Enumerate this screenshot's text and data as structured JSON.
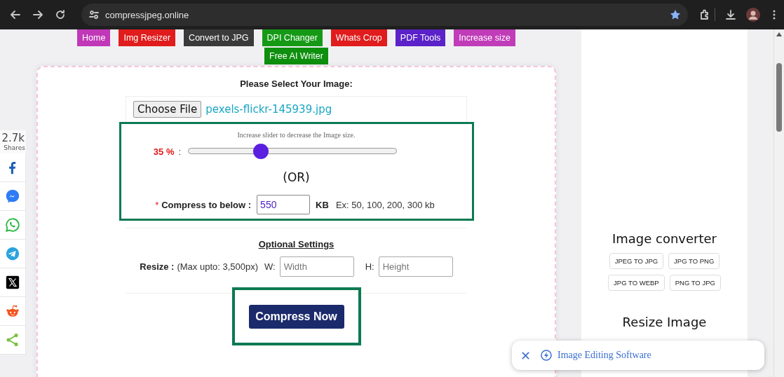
{
  "browser": {
    "url": "compressjpeg.online"
  },
  "nav": [
    {
      "label": "Home",
      "color": "#c038b8"
    },
    {
      "label": "Img Resizer",
      "color": "#e01c1c"
    },
    {
      "label": "Convert to JPG",
      "color": "#3a3a3a"
    },
    {
      "label": "DPI Changer",
      "color": "#169a16"
    },
    {
      "label": "Whats Crop",
      "color": "#e01c1c"
    },
    {
      "label": "PDF Tools",
      "color": "#5a22c8"
    },
    {
      "label": "Increase size",
      "color": "#c03cb8"
    },
    {
      "label": "Free AI Writer",
      "color": "#0e8f0e"
    }
  ],
  "share": {
    "count": "2.7k",
    "label": "Shares",
    "buttons": [
      {
        "kind": "facebook"
      },
      {
        "kind": "messenger"
      },
      {
        "kind": "whatsapp"
      },
      {
        "kind": "telegram"
      },
      {
        "kind": "x"
      },
      {
        "kind": "reddit"
      },
      {
        "kind": "share"
      }
    ]
  },
  "upload": {
    "heading": "Please Select Your Image:",
    "button": "Choose File",
    "file_name": "pexels-flickr-145939.jpg"
  },
  "quality": {
    "hint": "Increase slider to decrease the Image size.",
    "reading": "35 %",
    "separator": ":",
    "level": 0.35
  },
  "or_text": "(OR)",
  "target": {
    "required_mark": "*",
    "label": "Compress to below :",
    "value": "550",
    "unit": "KB",
    "example": "Ex: 50, 100, 200, 300 kb"
  },
  "optional": {
    "heading": "Optional Settings",
    "resize_label": "Resize :",
    "resize_note": "(Max upto: 3,500px)",
    "width_label": "W:",
    "width_placeholder": "Width",
    "height_label": "H:",
    "height_placeholder": "Height"
  },
  "submit": "Compress Now",
  "sidebar": {
    "sections": [
      {
        "title": "Image converter",
        "links": [
          "JPEG TO JPG",
          "JPG TO PNG",
          "JPG TO WEBP",
          "PNG TO JPG"
        ]
      },
      {
        "title": "Resize Image"
      }
    ]
  },
  "ad": {
    "text": "Image Editing Software"
  }
}
